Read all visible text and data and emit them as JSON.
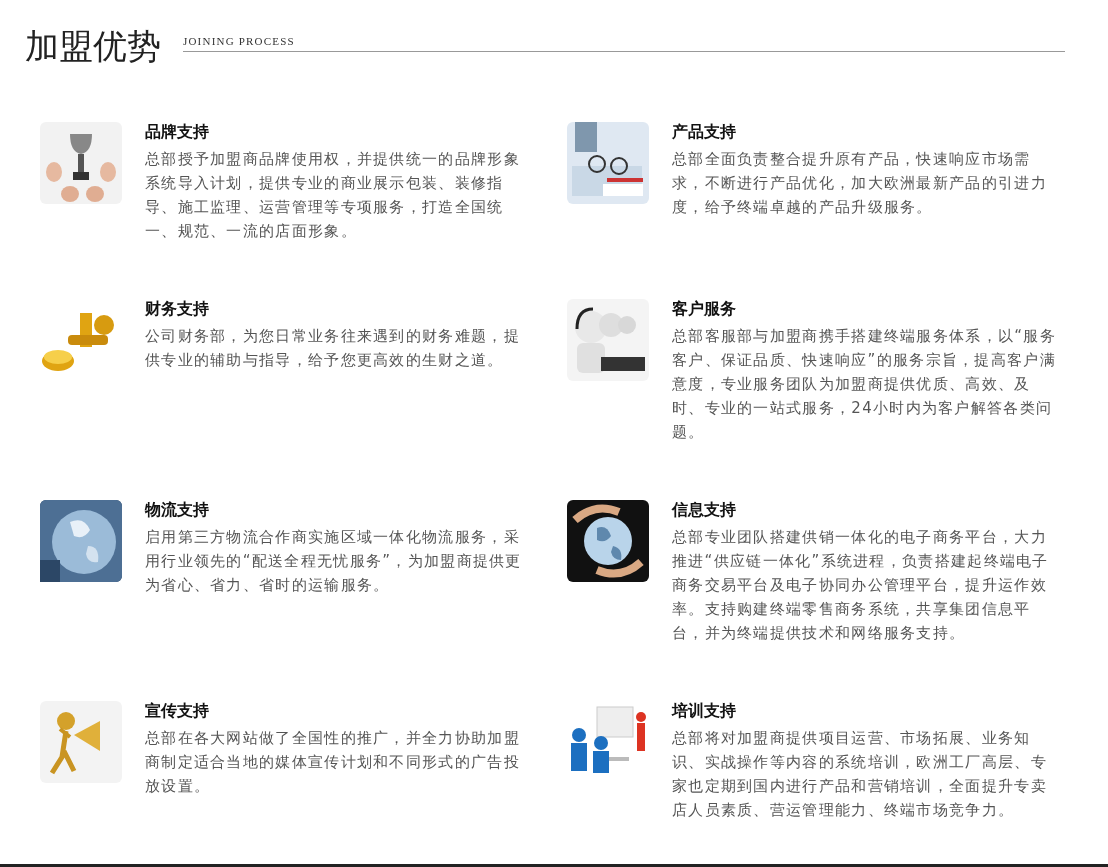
{
  "header": {
    "title": "加盟优势",
    "subtitle": "JOINING PROCESS"
  },
  "items": [
    {
      "title": "品牌支持",
      "text": "总部授予加盟商品牌使用权，并提供统一的品牌形象系统导入计划，提供专业的商业展示包装、装修指导、施工监理、运营管理等专项服务，打造全国统一、规范、一流的店面形象。"
    },
    {
      "title": "产品支持",
      "text": "总部全面负责整合提升原有产品，快速响应市场需求，不断进行产品优化，加大欧洲最新产品的引进力度，给予终端卓越的产品升级服务。"
    },
    {
      "title": "财务支持",
      "text": "公司财务部，为您日常业务往来遇到的财务难题，提供专业的辅助与指导，给予您更高效的生财之道。"
    },
    {
      "title": "客户服务",
      "text": "总部客服部与加盟商携手搭建终端服务体系，以“服务客户、保证品质、快速响应”的服务宗旨，提高客户满意度，专业服务团队为加盟商提供优质、高效、及时、专业的一站式服务，24小时内为客户解答各类问题。"
    },
    {
      "title": "物流支持",
      "text": "启用第三方物流合作商实施区域一体化物流服务，采用行业领先的“配送全程无忧服务”，为加盟商提供更为省心、省力、省时的运输服务。"
    },
    {
      "title": "信息支持",
      "text": "总部专业团队搭建供销一体化的电子商务平台，大力推进“供应链一体化”系统进程，负责搭建起终端电子商务交易平台及电子协同办公管理平台，提升运作效率。支持购建终端零售商务系统，共享集团信息平台，并为终端提供技术和网络服务支持。"
    },
    {
      "title": "宣传支持",
      "text": "总部在各大网站做了全国性的推广，并全力协助加盟商制定适合当地的媒体宣传计划和不同形式的广告投放设置。"
    },
    {
      "title": "培训支持",
      "text": "总部将对加盟商提供项目运营、市场拓展、业务知识、实战操作等内容的系统培训，欧洲工厂高层、专家也定期到国内进行产品和营销培训，全面提升专卖店人员素质、营运管理能力、终端市场竞争力。"
    }
  ]
}
